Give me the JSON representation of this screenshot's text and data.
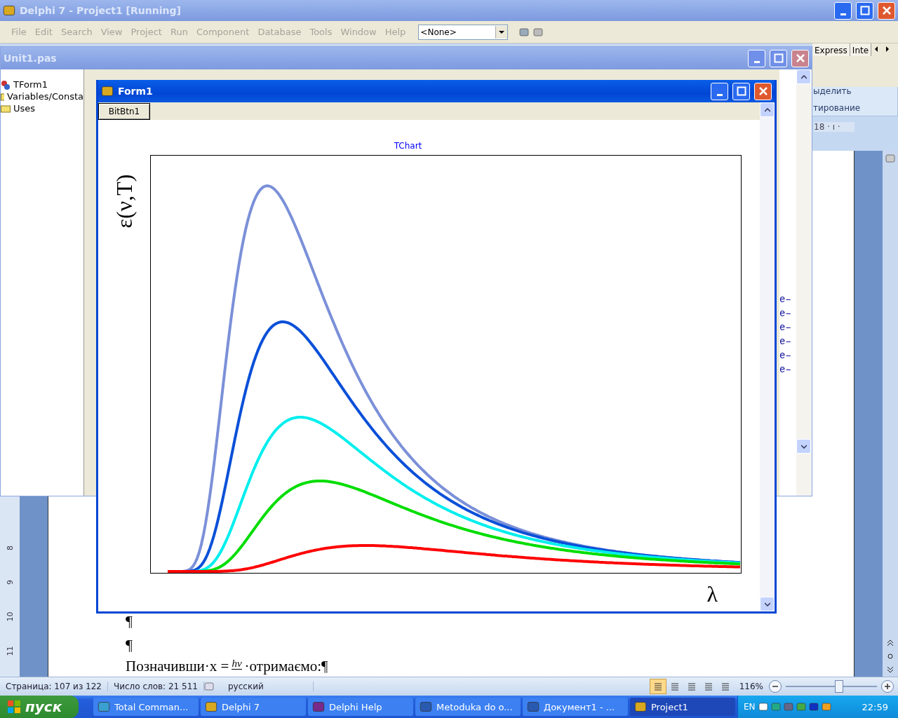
{
  "word": {
    "ribbon_fragments": [
      "ыделить",
      "тирование"
    ],
    "ruler_top": "18 · ı ·",
    "ruler_numbers": [
      "8",
      "9",
      "10",
      "11"
    ],
    "paragraph_marks": [
      "¶",
      "¶"
    ],
    "formula": {
      "before": "Позначивши·x =",
      "numerator": "hν",
      "after": "·отримаємо:¶"
    },
    "status_bar": {
      "page": "Страница: 107 из 122",
      "words": "Число слов: 21 511",
      "language": "русский",
      "views": [
        {
          "selected": true
        },
        {
          "selected": false
        },
        {
          "selected": false
        },
        {
          "selected": false
        },
        {
          "selected": false
        }
      ],
      "zoom": "116%",
      "zoom_slider": {
        "level": 0.58
      }
    }
  },
  "delphi": {
    "title": "Delphi 7 - Project1 [Running]",
    "menu": [
      "File",
      "Edit",
      "Search",
      "View",
      "Project",
      "Run",
      "Component",
      "Database",
      "Tools",
      "Window",
      "Help"
    ],
    "object_combo": "<None>",
    "palette_tabs": [
      "Express",
      "Inte"
    ]
  },
  "editor": {
    "title": "Unit1.pas",
    "explorer_items": [
      {
        "label": "TForm1",
        "kind": "class"
      },
      {
        "label": "Variables/Consta",
        "kind": "folder"
      },
      {
        "label": "Uses",
        "kind": "folder"
      }
    ],
    "code_fragments": [
      "e–",
      "e–",
      "e–",
      "e–",
      "e–",
      "e–"
    ]
  },
  "form": {
    "title": "Form1",
    "button": "BitBtn1",
    "chart": {
      "title": "TChart",
      "ylabel": "ε(ν,T)",
      "xlabel": "λ",
      "curves": [
        {
          "color": "#7b90d8"
        },
        {
          "color": "#0a50d8"
        },
        {
          "color": "#00eeee"
        },
        {
          "color": "#00dd00"
        },
        {
          "color": "#ff0000"
        }
      ]
    }
  },
  "taskbar": {
    "start": "пуск",
    "tasks": [
      {
        "label": "Total Comman...",
        "kind": "tc",
        "selected": false
      },
      {
        "label": "Delphi 7",
        "kind": "delphi",
        "selected": false
      },
      {
        "label": "Delphi Help",
        "kind": "help",
        "selected": false
      },
      {
        "label": "Metoduka do o...",
        "kind": "word",
        "selected": false
      },
      {
        "label": "Документ1 - ...",
        "kind": "word",
        "selected": false
      },
      {
        "label": "Project1",
        "kind": "delphi",
        "selected": true
      }
    ],
    "language": "EN",
    "clock": "22:59"
  }
}
